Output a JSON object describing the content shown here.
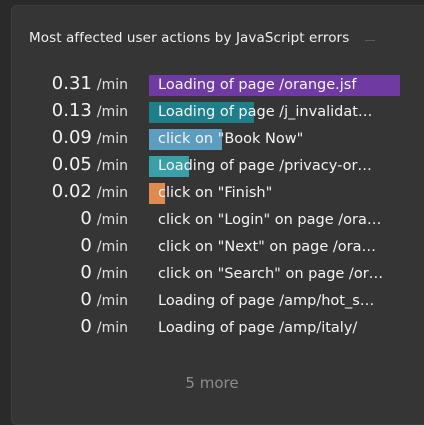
{
  "widget": {
    "title": "Most affected user actions by JavaScript errors",
    "more_label": "5 more",
    "max_value": 0.31,
    "rows": [
      {
        "value": "0.31",
        "unit": "/min",
        "label": "Loading of page /orange.jsf",
        "amount": 0.31,
        "color": "#6f3aa1"
      },
      {
        "value": "0.13",
        "unit": "/min",
        "label": "Loading of page /j_invalidat…",
        "amount": 0.13,
        "color": "#1e7f8a"
      },
      {
        "value": "0.09",
        "unit": "/min",
        "label": "click on \"Book Now\"",
        "amount": 0.09,
        "color": "#5d9dbf"
      },
      {
        "value": "0.05",
        "unit": "/min",
        "label": "Loading of page /privacy-or…",
        "amount": 0.05,
        "color": "#3aa0a8"
      },
      {
        "value": "0.02",
        "unit": "/min",
        "label": "click on \"Finish\"",
        "amount": 0.02,
        "color": "#e08a52"
      },
      {
        "value": "0",
        "unit": "/min",
        "label": "click on \"Login\" on page /ora…",
        "amount": 0,
        "color": "#6f3aa1"
      },
      {
        "value": "0",
        "unit": "/min",
        "label": "click on \"Next\" on page /ora…",
        "amount": 0,
        "color": "#6f3aa1"
      },
      {
        "value": "0",
        "unit": "/min",
        "label": "click on \"Search\" on page /or…",
        "amount": 0,
        "color": "#6f3aa1"
      },
      {
        "value": "0",
        "unit": "/min",
        "label": "Loading of page /amp/hot_s…",
        "amount": 0,
        "color": "#6f3aa1"
      },
      {
        "value": "0",
        "unit": "/min",
        "label": "Loading of page /amp/italy/",
        "amount": 0,
        "color": "#6f3aa1"
      }
    ]
  }
}
